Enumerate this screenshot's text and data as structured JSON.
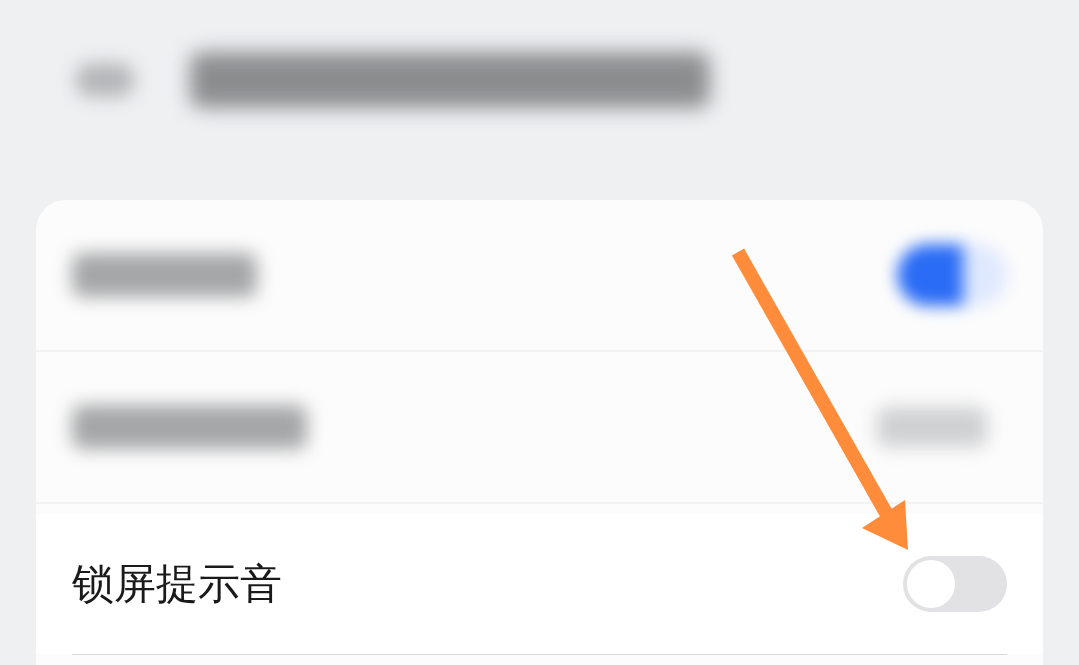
{
  "header": {
    "kind": "blurred"
  },
  "rows": [
    {
      "kind": "blurred-toggle",
      "on": true
    },
    {
      "kind": "blurred-value"
    },
    {
      "kind": "toggle",
      "label": "锁屏提示音",
      "on": false
    }
  ],
  "annotation": {
    "kind": "arrow"
  }
}
